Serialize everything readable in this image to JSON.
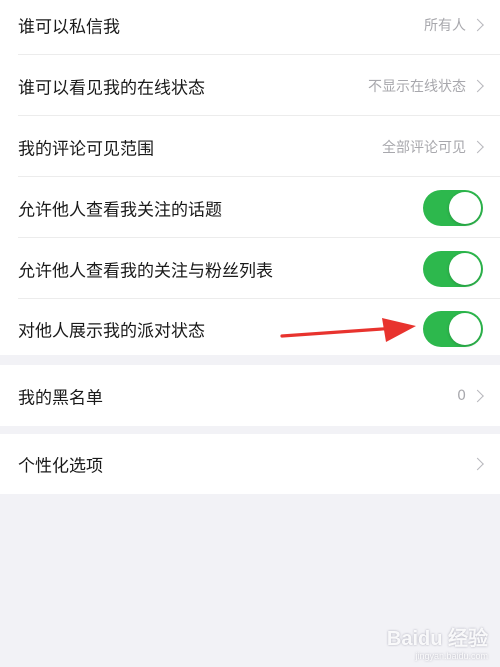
{
  "privacy_group": {
    "rows": [
      {
        "label": "谁可以私信我",
        "value": "所有人"
      },
      {
        "label": "谁可以看见我的在线状态",
        "value": "不显示在线状态"
      },
      {
        "label": "我的评论可见范围",
        "value": "全部评论可见"
      }
    ],
    "toggles": [
      {
        "label": "允许他人查看我关注的话题",
        "on": true
      },
      {
        "label": "允许他人查看我的关注与粉丝列表",
        "on": true
      },
      {
        "label": "对他人展示我的派对状态",
        "on": true
      }
    ]
  },
  "blacklist": {
    "label": "我的黑名单",
    "value": "0"
  },
  "personalization": {
    "label": "个性化选项"
  },
  "watermark": {
    "brand": "Baidu 经验",
    "url": "jingyan.baidu.com"
  },
  "colors": {
    "toggle_on": "#2db84d",
    "annotation_arrow": "#e8332e",
    "background": "#f2f2f6"
  }
}
